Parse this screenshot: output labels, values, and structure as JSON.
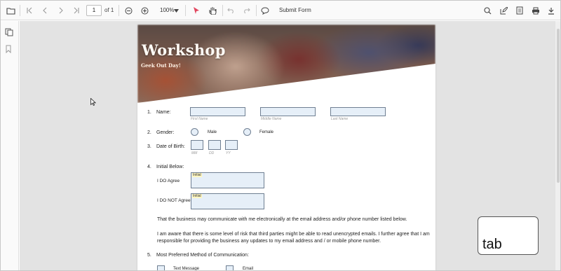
{
  "toolbar": {
    "page_value": "1",
    "page_of": "of 1",
    "zoom": "100%",
    "submit_label": "Submit Form"
  },
  "document": {
    "banner_title": "Workshop",
    "banner_subtitle": "Geek Out Day!",
    "q1": {
      "num": "1.",
      "label": "Name:",
      "hints": [
        "First Name",
        "Middle Name",
        "Last Name"
      ]
    },
    "q2": {
      "num": "2.",
      "label": "Gender:",
      "options": [
        "Male",
        "Female"
      ]
    },
    "q3": {
      "num": "3.",
      "label": "Date of Birth:",
      "hints": [
        "MM",
        "DD",
        "YY"
      ]
    },
    "q4": {
      "num": "4.",
      "label": "Initial Below:",
      "agree": "I DO Agree",
      "not_agree": "I DO NOT Agree",
      "initial_tag": "Initial"
    },
    "para1": "That the business may communicate with me electronically at the email address and/or phone number listed below.",
    "para2": "I am aware that there is some level of risk that third parties might be able to read unencrypted emails. I further agree that I am responsible for providing the business any updates to my email address and / or mobile phone number.",
    "q5": {
      "num": "5.",
      "label": "Most Preferred Method of Communication:",
      "options": [
        "Text Message",
        "Email"
      ]
    }
  },
  "overlay": {
    "key_hint": "tab"
  },
  "colors": {
    "field_fill": "#e6eff8",
    "field_border": "#6f7f92",
    "viewer_bg": "#e3e3e3"
  }
}
